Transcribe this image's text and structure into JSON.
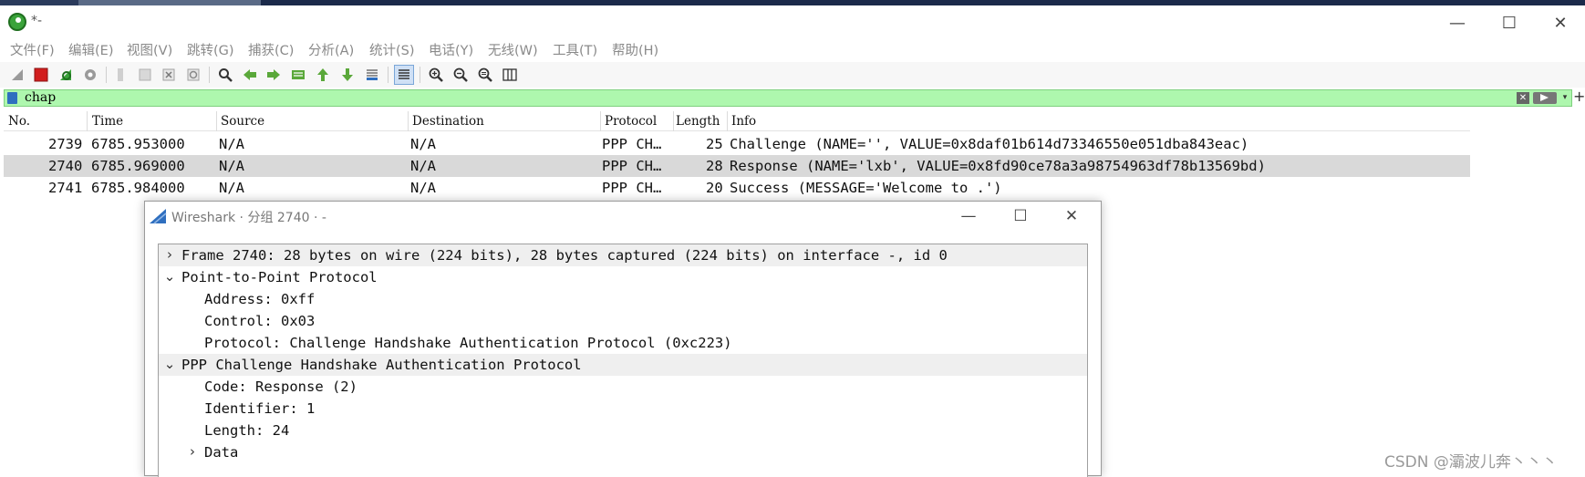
{
  "window": {
    "title": "*-",
    "minimize_glyph": "—",
    "maximize_glyph": "☐",
    "close_glyph": "✕"
  },
  "menu": [
    "文件(F)",
    "编辑(E)",
    "视图(V)",
    "跳转(G)",
    "捕获(C)",
    "分析(A)",
    "统计(S)",
    "电话(Y)",
    "无线(W)",
    "工具(T)",
    "帮助(H)"
  ],
  "toolbar": {
    "icons": [
      "shark-fin-start-icon",
      "stop-capture-icon",
      "restart-capture-icon",
      "capture-options-icon",
      "open-file-icon",
      "save-file-icon",
      "close-file-icon",
      "reload-file-icon",
      "find-packet-icon",
      "go-back-icon",
      "go-forward-icon",
      "go-to-packet-icon",
      "go-first-icon",
      "go-last-icon",
      "auto-scroll-icon",
      "colorize-icon",
      "zoom-in-icon",
      "zoom-out-icon",
      "normal-size-icon",
      "resize-columns-icon"
    ]
  },
  "filter": {
    "value": "chap",
    "clear_glyph": "✕",
    "dropdown_glyph": "▾",
    "add_glyph": "+"
  },
  "packet_list": {
    "columns": [
      "No.",
      "Time",
      "Source",
      "Destination",
      "Protocol",
      "Length",
      "Info"
    ],
    "rows": [
      {
        "no": "2739",
        "time": "6785.953000",
        "source": "N/A",
        "destination": "N/A",
        "protocol": "PPP CH…",
        "length": "25",
        "info": "Challenge (NAME='', VALUE=0x8daf01b614d73346550e051dba843eac)"
      },
      {
        "no": "2740",
        "time": "6785.969000",
        "source": "N/A",
        "destination": "N/A",
        "protocol": "PPP CH…",
        "length": "28",
        "info": "Response (NAME='lxb', VALUE=0x8fd90ce78a3a98754963df78b13569bd)"
      },
      {
        "no": "2741",
        "time": "6785.984000",
        "source": "N/A",
        "destination": "N/A",
        "protocol": "PPP CH…",
        "length": "20",
        "info": "Success (MESSAGE='Welcome to .')"
      }
    ]
  },
  "popup": {
    "title": "Wireshark · 分组 2740 · -",
    "tree": [
      {
        "arrow": "›",
        "text": "Frame 2740: 28 bytes on wire (224 bits), 28 bytes captured (224 bits) on interface -, id 0"
      },
      {
        "arrow": "⌄",
        "text": "Point-to-Point Protocol"
      },
      {
        "arrow": "",
        "text": "Address: 0xff"
      },
      {
        "arrow": "",
        "text": "Control: 0x03"
      },
      {
        "arrow": "",
        "text": "Protocol: Challenge Handshake Authentication Protocol (0xc223)"
      },
      {
        "arrow": "⌄",
        "text": "PPP Challenge Handshake Authentication Protocol"
      },
      {
        "arrow": "",
        "text": "Code: Response (2)"
      },
      {
        "arrow": "",
        "text": "Identifier: 1"
      },
      {
        "arrow": "",
        "text": "Length: 24"
      },
      {
        "arrow": "›",
        "text": "Data"
      }
    ]
  },
  "watermark": "CSDN @灞波儿奔丶丶丶",
  "colors": {
    "filter_bg": "#aef7ae",
    "selected_row": "#d9d9d9",
    "stop_red": "#d21f1f",
    "shark_blue": "#2f6fbf"
  }
}
